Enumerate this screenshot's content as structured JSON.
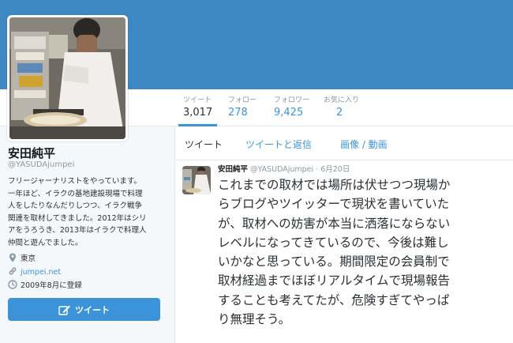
{
  "colors": {
    "banner": "#3b88c3",
    "accent": "#3b94d9",
    "background": "#f5f8fa",
    "text": "#292f33",
    "muted": "#8899a6"
  },
  "nav": {
    "stats": [
      {
        "label": "ツイート",
        "value": "3,017"
      },
      {
        "label": "フォロー",
        "value": "278"
      },
      {
        "label": "フォロワー",
        "value": "9,425"
      },
      {
        "label": "お気に入り",
        "value": "2"
      }
    ]
  },
  "profile": {
    "name": "安田純平",
    "handle": "@YASUDAjumpei",
    "bio_lines": [
      "フリージャーナリストをやっています。",
      "一年ほど、イラクの基地建設現場で料理",
      "人をしたりなんだりしつつ、イラク戦争",
      "関連を取材してきました。2012年はシリ",
      "アをうろうき、2013年はイラクで料理人",
      "仲間と遊んでました。"
    ],
    "location": "東京",
    "url": "jumpei.net",
    "joined": "2009年8月に登録",
    "tweet_button": "ツイート"
  },
  "timeline": {
    "tabs": [
      "ツイート",
      "ツイートと返信",
      "画像 / 動画"
    ],
    "tweet": {
      "name": "安田純平",
      "handle": "@YASUDAjumpei",
      "separator": "·",
      "date": "6月20日",
      "text_lines": [
        "これまでの取材では場所は伏せつつ現場か",
        "らブログやツイッターで現状を書いていた",
        "が、取材への妨害が本当に洒落にならない",
        "レベルになってきているので、今後は難し",
        "いかなと思っている。期間限定の会員制で",
        "取材経過までほぼリアルタイムで現場報告",
        "することも考えてたが、危険すぎてやっぱ",
        "り無理そう。"
      ]
    }
  },
  "icons": [
    "location-pin-icon",
    "link-icon",
    "calendar-icon",
    "compose-icon"
  ]
}
